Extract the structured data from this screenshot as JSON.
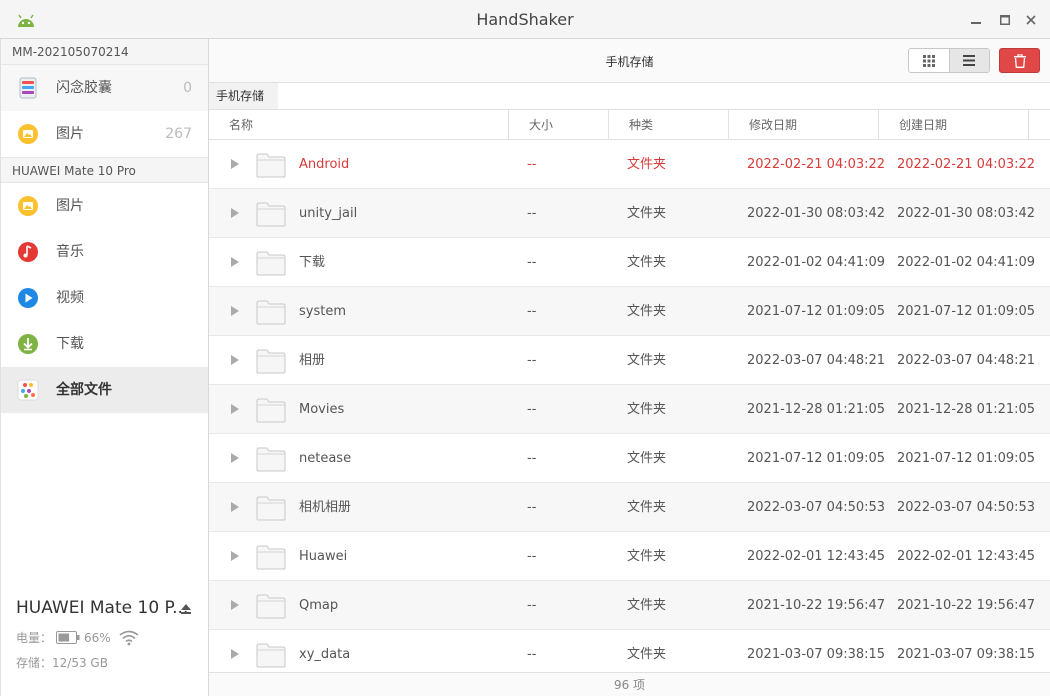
{
  "window": {
    "title": "HandShaker",
    "icon": "android-icon"
  },
  "sidebar": {
    "device1": {
      "name": "MM-202105070214",
      "items": [
        {
          "label": "闪念胶囊",
          "count": "0",
          "icon": "capsule-icon"
        },
        {
          "label": "图片",
          "count": "267",
          "icon": "picture-icon"
        }
      ]
    },
    "device2": {
      "name": "HUAWEI Mate 10 Pro",
      "items": [
        {
          "label": "图片",
          "icon": "picture-icon"
        },
        {
          "label": "音乐",
          "icon": "music-icon"
        },
        {
          "label": "视频",
          "icon": "video-icon"
        },
        {
          "label": "下载",
          "icon": "download-icon"
        },
        {
          "label": "全部文件",
          "icon": "all-files-icon"
        }
      ]
    },
    "footer": {
      "device_name": "HUAWEI Mate 10 P...",
      "battery_label": "电量：",
      "battery_value": "66%",
      "battery_level": 0.66,
      "storage_label": "存储：",
      "storage_value": "12/53 GB"
    }
  },
  "toolbar": {
    "title": "手机存储"
  },
  "breadcrumb": {
    "current": "手机存储"
  },
  "table": {
    "columns": [
      "名称",
      "大小",
      "种类",
      "修改日期",
      "创建日期"
    ],
    "rows": [
      {
        "name": "Android",
        "size": "--",
        "kind": "文件夹",
        "modified": "2022-02-21 04:03:22",
        "created": "2022-02-21 04:03:22"
      },
      {
        "name": "unity_jail",
        "size": "--",
        "kind": "文件夹",
        "modified": "2022-01-30 08:03:42",
        "created": "2022-01-30 08:03:42"
      },
      {
        "name": "下载",
        "size": "--",
        "kind": "文件夹",
        "modified": "2022-01-02 04:41:09",
        "created": "2022-01-02 04:41:09"
      },
      {
        "name": "system",
        "size": "--",
        "kind": "文件夹",
        "modified": "2021-07-12 01:09:05",
        "created": "2021-07-12 01:09:05"
      },
      {
        "name": "相册",
        "size": "--",
        "kind": "文件夹",
        "modified": "2022-03-07 04:48:21",
        "created": "2022-03-07 04:48:21"
      },
      {
        "name": "Movies",
        "size": "--",
        "kind": "文件夹",
        "modified": "2021-12-28 01:21:05",
        "created": "2021-12-28 01:21:05"
      },
      {
        "name": "netease",
        "size": "--",
        "kind": "文件夹",
        "modified": "2021-07-12 01:09:05",
        "created": "2021-07-12 01:09:05"
      },
      {
        "name": "相机相册",
        "size": "--",
        "kind": "文件夹",
        "modified": "2022-03-07 04:50:53",
        "created": "2022-03-07 04:50:53"
      },
      {
        "name": "Huawei",
        "size": "--",
        "kind": "文件夹",
        "modified": "2022-02-01 12:43:45",
        "created": "2022-02-01 12:43:45"
      },
      {
        "name": "Qmap",
        "size": "--",
        "kind": "文件夹",
        "modified": "2021-10-22 19:56:47",
        "created": "2021-10-22 19:56:47"
      },
      {
        "name": "xy_data",
        "size": "--",
        "kind": "文件夹",
        "modified": "2021-03-07 09:38:15",
        "created": "2021-03-07 09:38:15"
      }
    ]
  },
  "status": {
    "count": "96 项"
  },
  "colors": {
    "accent_red": "#d83b3b",
    "delete_button": "#e04848"
  }
}
